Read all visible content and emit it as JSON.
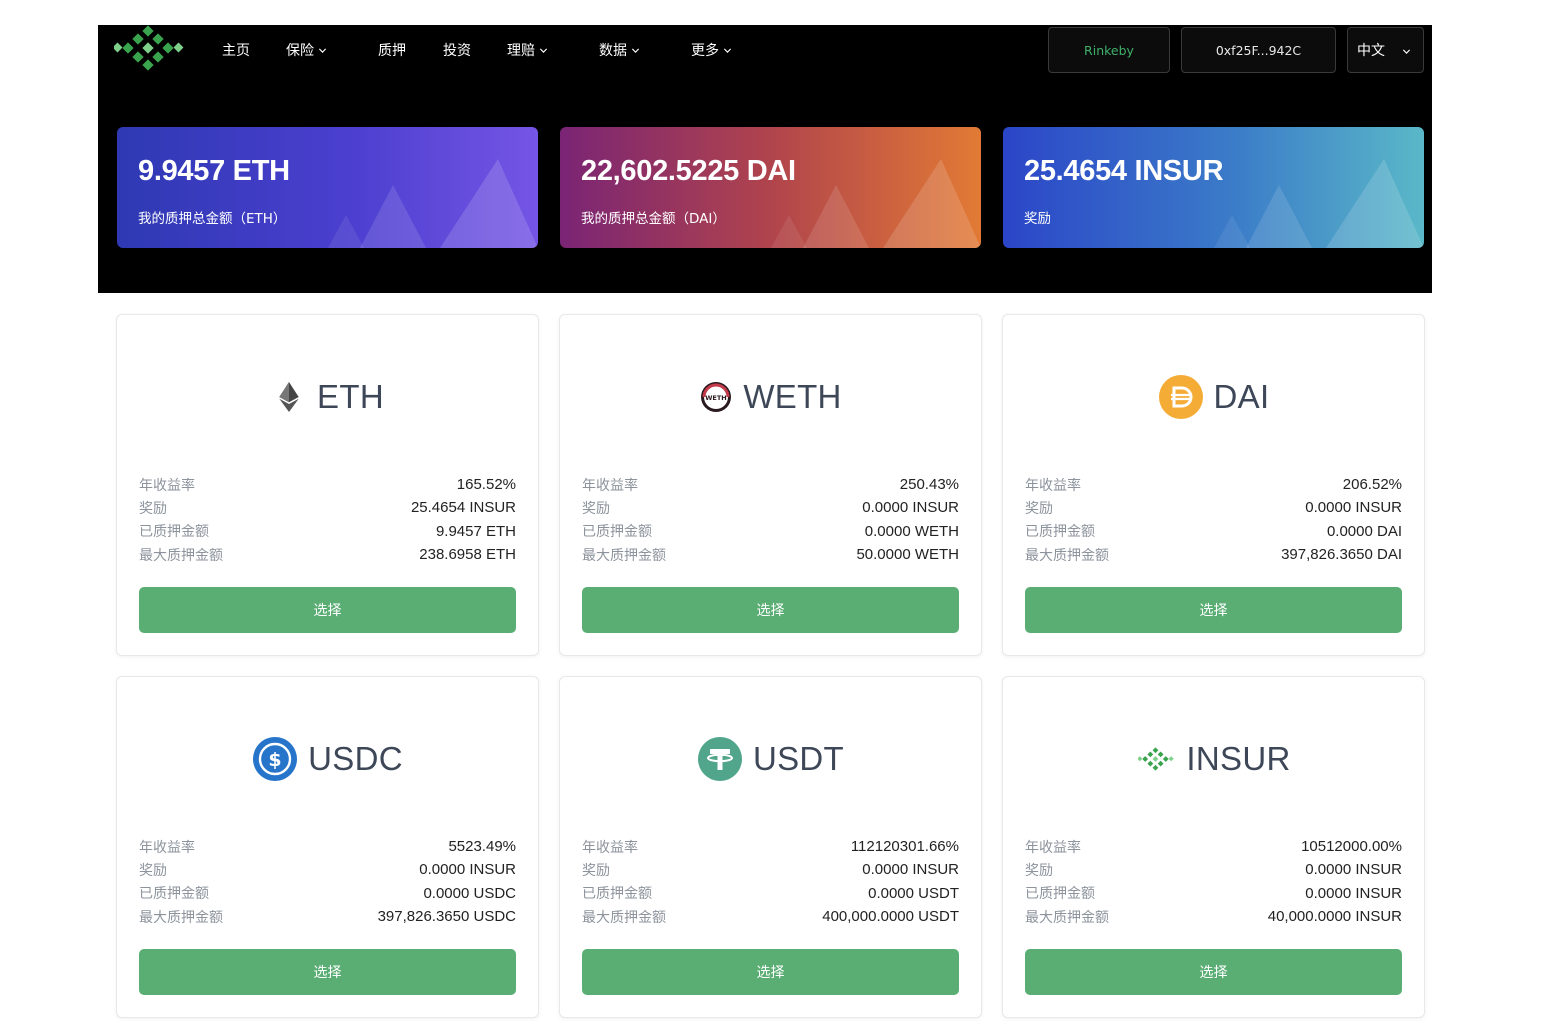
{
  "nav": {
    "items": [
      {
        "label": "主页",
        "dropdown": false
      },
      {
        "label": "保险",
        "dropdown": true
      },
      {
        "label": "质押",
        "dropdown": false
      },
      {
        "label": "投资",
        "dropdown": false
      },
      {
        "label": "理赔",
        "dropdown": true
      },
      {
        "label": "数据",
        "dropdown": true
      },
      {
        "label": "更多",
        "dropdown": true
      }
    ],
    "network": "Rinkeby",
    "address": "0xf25F...942C",
    "language": "中文"
  },
  "stats": [
    {
      "value": "9.9457 ETH",
      "label": "我的质押总金额（ETH）"
    },
    {
      "value": "22,602.5225 DAI",
      "label": "我的质押总金额（DAI）"
    },
    {
      "value": "25.4654 INSUR",
      "label": "奖励"
    }
  ],
  "cards": [
    {
      "token": "ETH",
      "icon": "eth-icon",
      "rows": [
        {
          "label": "年收益率",
          "value": "165.52%"
        },
        {
          "label": "奖励",
          "value": "25.4654 INSUR"
        },
        {
          "label": "已质押金额",
          "value": "9.9457 ETH"
        },
        {
          "label": "最大质押金额",
          "value": "238.6958 ETH"
        }
      ],
      "button": "选择"
    },
    {
      "token": "WETH",
      "icon": "weth-icon",
      "rows": [
        {
          "label": "年收益率",
          "value": "250.43%"
        },
        {
          "label": "奖励",
          "value": "0.0000 INSUR"
        },
        {
          "label": "已质押金额",
          "value": "0.0000 WETH"
        },
        {
          "label": "最大质押金额",
          "value": "50.0000 WETH"
        }
      ],
      "button": "选择"
    },
    {
      "token": "DAI",
      "icon": "dai-icon",
      "rows": [
        {
          "label": "年收益率",
          "value": "206.52%"
        },
        {
          "label": "奖励",
          "value": "0.0000 INSUR"
        },
        {
          "label": "已质押金额",
          "value": "0.0000 DAI"
        },
        {
          "label": "最大质押金额",
          "value": "397,826.3650 DAI"
        }
      ],
      "button": "选择"
    },
    {
      "token": "USDC",
      "icon": "usdc-icon",
      "rows": [
        {
          "label": "年收益率",
          "value": "5523.49%"
        },
        {
          "label": "奖励",
          "value": "0.0000 INSUR"
        },
        {
          "label": "已质押金额",
          "value": "0.0000 USDC"
        },
        {
          "label": "最大质押金额",
          "value": "397,826.3650 USDC"
        }
      ],
      "button": "选择"
    },
    {
      "token": "USDT",
      "icon": "usdt-icon",
      "rows": [
        {
          "label": "年收益率",
          "value": "112120301.66%"
        },
        {
          "label": "奖励",
          "value": "0.0000 INSUR"
        },
        {
          "label": "已质押金额",
          "value": "0.0000 USDT"
        },
        {
          "label": "最大质押金额",
          "value": "400,000.0000 USDT"
        }
      ],
      "button": "选择"
    },
    {
      "token": "INSUR",
      "icon": "insur-icon",
      "rows": [
        {
          "label": "年收益率",
          "value": "10512000.00%"
        },
        {
          "label": "奖励",
          "value": "0.0000 INSUR"
        },
        {
          "label": "已质押金额",
          "value": "0.0000 INSUR"
        },
        {
          "label": "最大质押金额",
          "value": "40,000.0000 INSUR"
        }
      ],
      "button": "选择"
    }
  ],
  "colors": {
    "accent_green": "#5aae74",
    "network_green": "#3fb06a",
    "header_bg": "#000000"
  }
}
